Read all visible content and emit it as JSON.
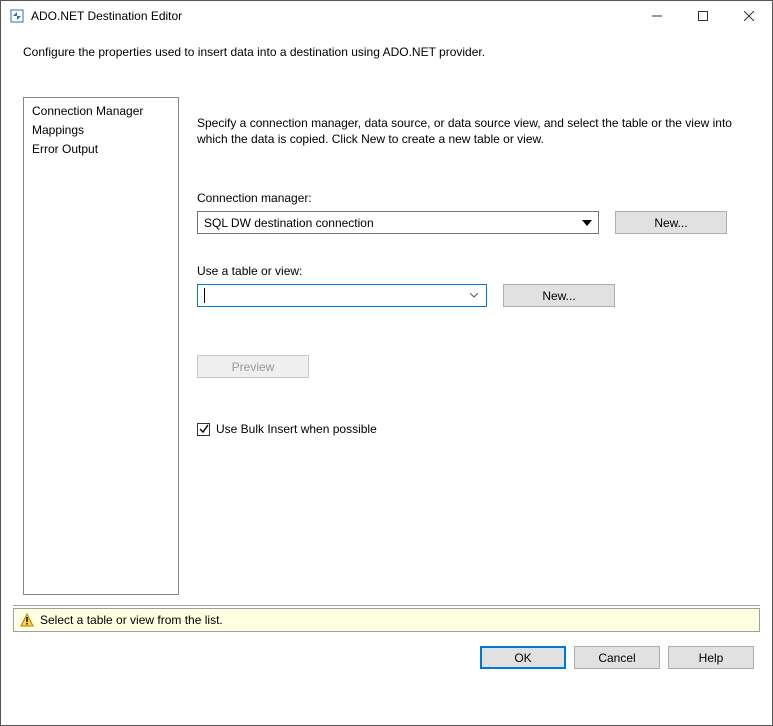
{
  "window": {
    "title": "ADO.NET Destination Editor"
  },
  "description": "Configure the properties used to insert data into a destination using ADO.NET provider.",
  "sidebar": {
    "items": [
      {
        "label": "Connection Manager"
      },
      {
        "label": "Mappings"
      },
      {
        "label": "Error Output"
      }
    ]
  },
  "main": {
    "instructions": "Specify a connection manager, data source, or data source view, and select the table or the view into which the data is copied. Click New to create a new table or view.",
    "conn_label": "Connection manager:",
    "conn_value": "SQL DW destination connection",
    "new_btn": "New...",
    "table_label": "Use a table or view:",
    "table_value": "",
    "preview_btn": "Preview",
    "bulk_label": "Use Bulk Insert when possible"
  },
  "status": {
    "message": "Select a table or view from the list."
  },
  "footer": {
    "ok": "OK",
    "cancel": "Cancel",
    "help": "Help"
  }
}
